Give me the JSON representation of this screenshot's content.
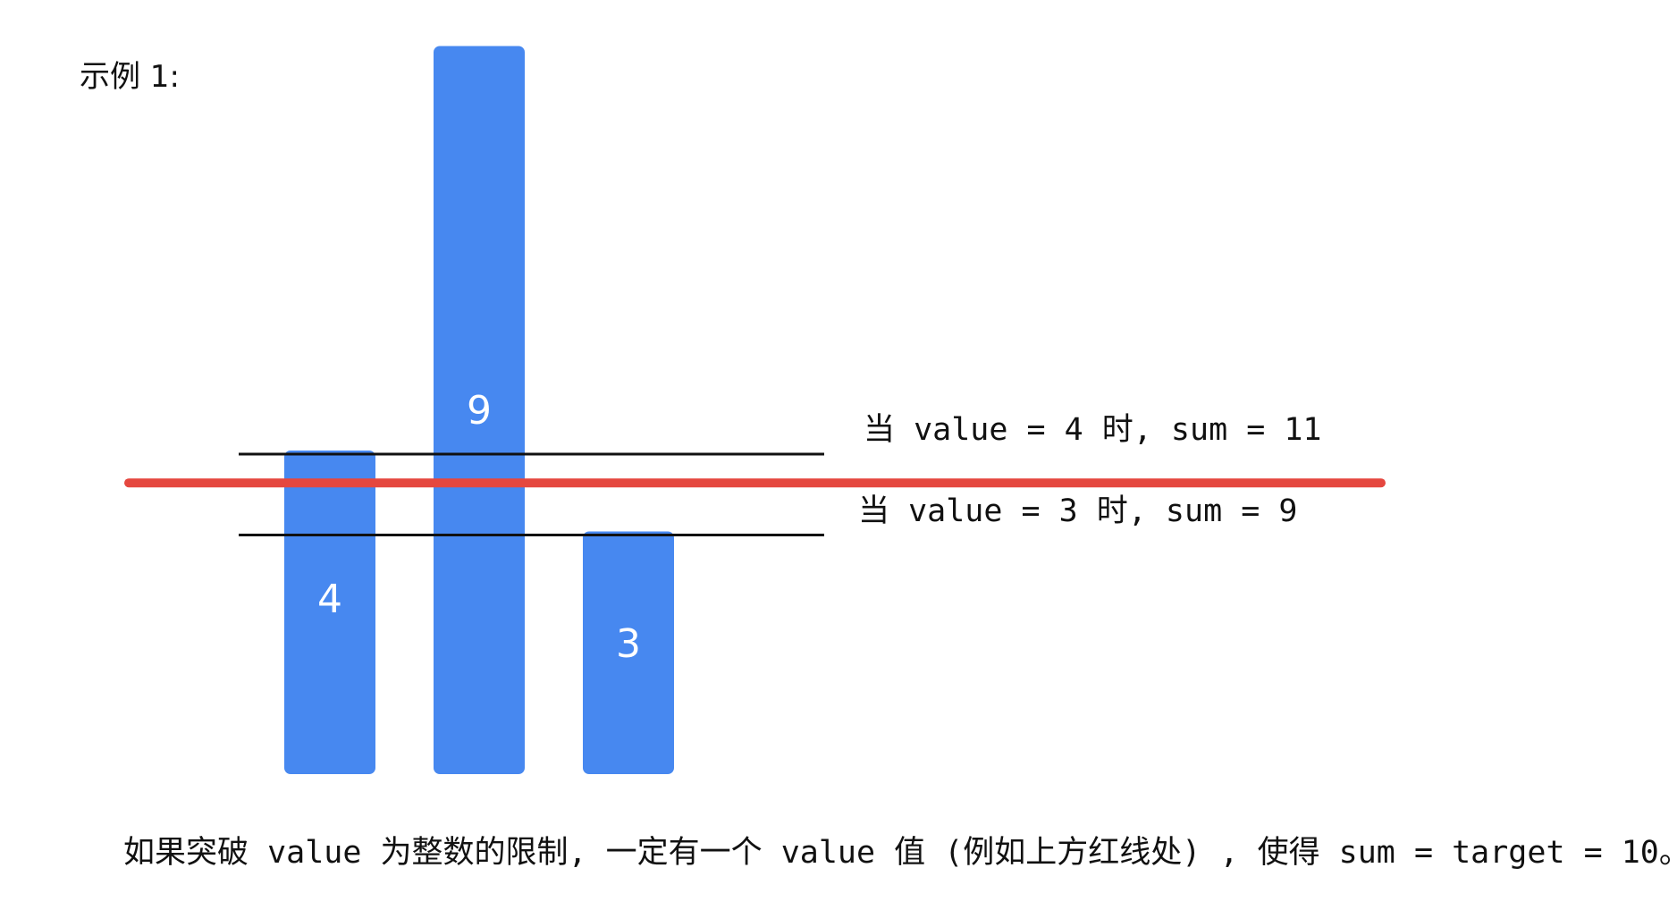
{
  "example_label": "示例 1:",
  "bars": [
    {
      "value": 4,
      "label": "4"
    },
    {
      "value": 9,
      "label": "9"
    },
    {
      "value": 3,
      "label": "3"
    }
  ],
  "threshold_lines": [
    {
      "value": 4,
      "text": "当 value = 4 时, sum = 11"
    },
    {
      "value": 3,
      "text": "当 value = 3 时, sum = 9"
    }
  ],
  "target_line": {
    "value": 3.6
  },
  "caption": "如果突破 value 为整数的限制, 一定有一个 value 值 (例如上方红线处) , 使得 sum = target = 10。",
  "colors": {
    "bar": "#4788F0",
    "bar_text": "#ffffff",
    "threshold_line": "#111111",
    "target_line": "#E5473F"
  }
}
